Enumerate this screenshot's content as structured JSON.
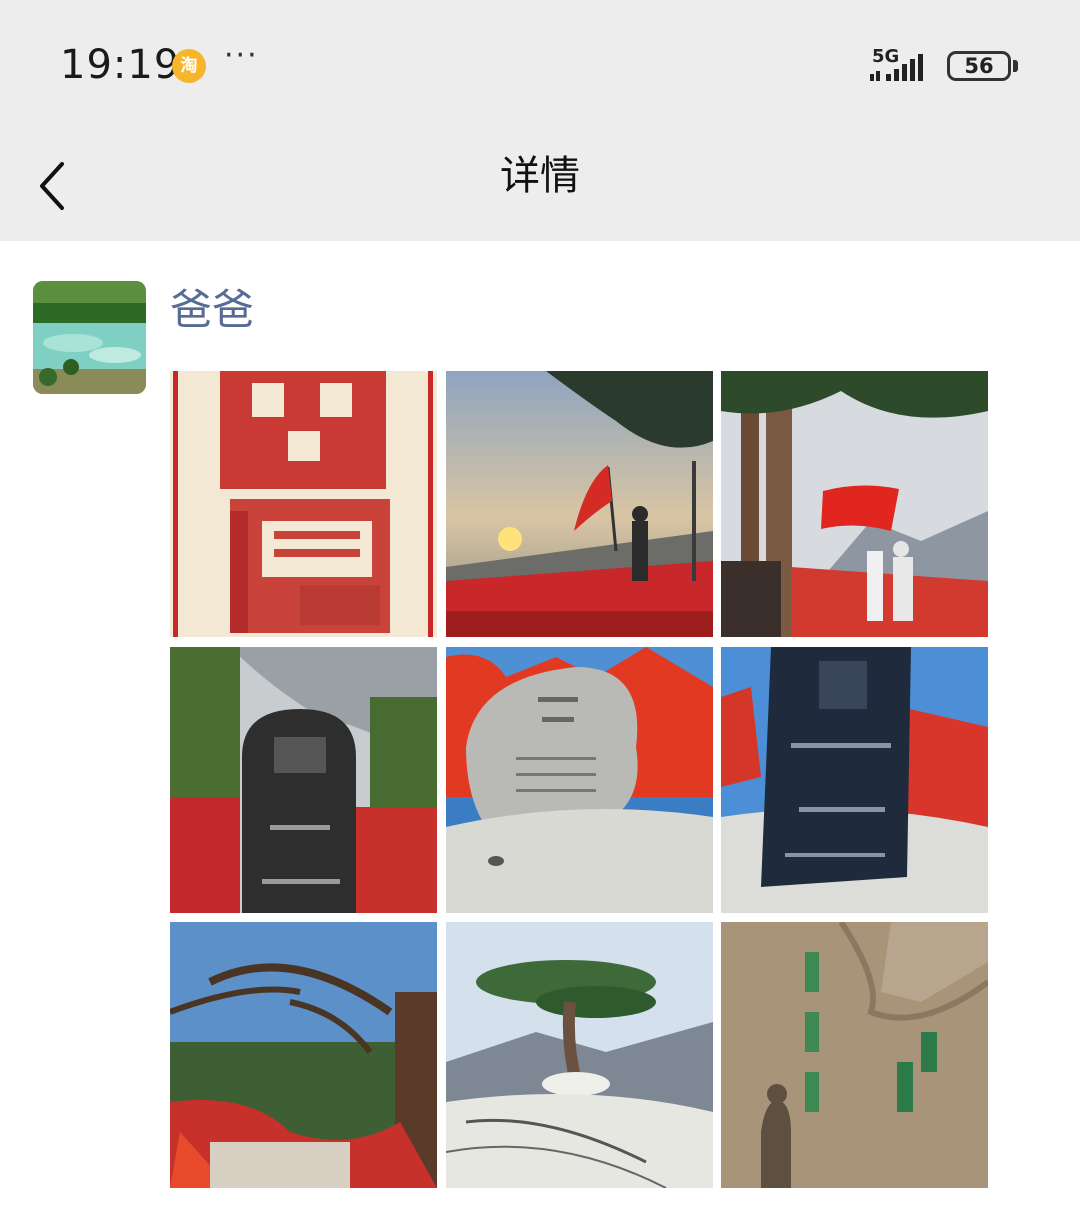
{
  "status_bar": {
    "time": "19:19",
    "app_badge": "淘",
    "more": "···",
    "network": "5G",
    "battery": "56"
  },
  "nav": {
    "title": "详情",
    "back_icon": "chevron-left-icon"
  },
  "post": {
    "author": "爸爸",
    "photos": [
      {
        "name": "photo-paper-cut-art"
      },
      {
        "name": "photo-sunrise-flag"
      },
      {
        "name": "photo-flag-trees"
      },
      {
        "name": "photo-north-peak-stele"
      },
      {
        "name": "photo-huashan-rock"
      },
      {
        "name": "photo-west-peak-stele"
      },
      {
        "name": "photo-red-ribbon-tree"
      },
      {
        "name": "photo-welcoming-pine"
      },
      {
        "name": "photo-rock-inscription"
      }
    ]
  }
}
